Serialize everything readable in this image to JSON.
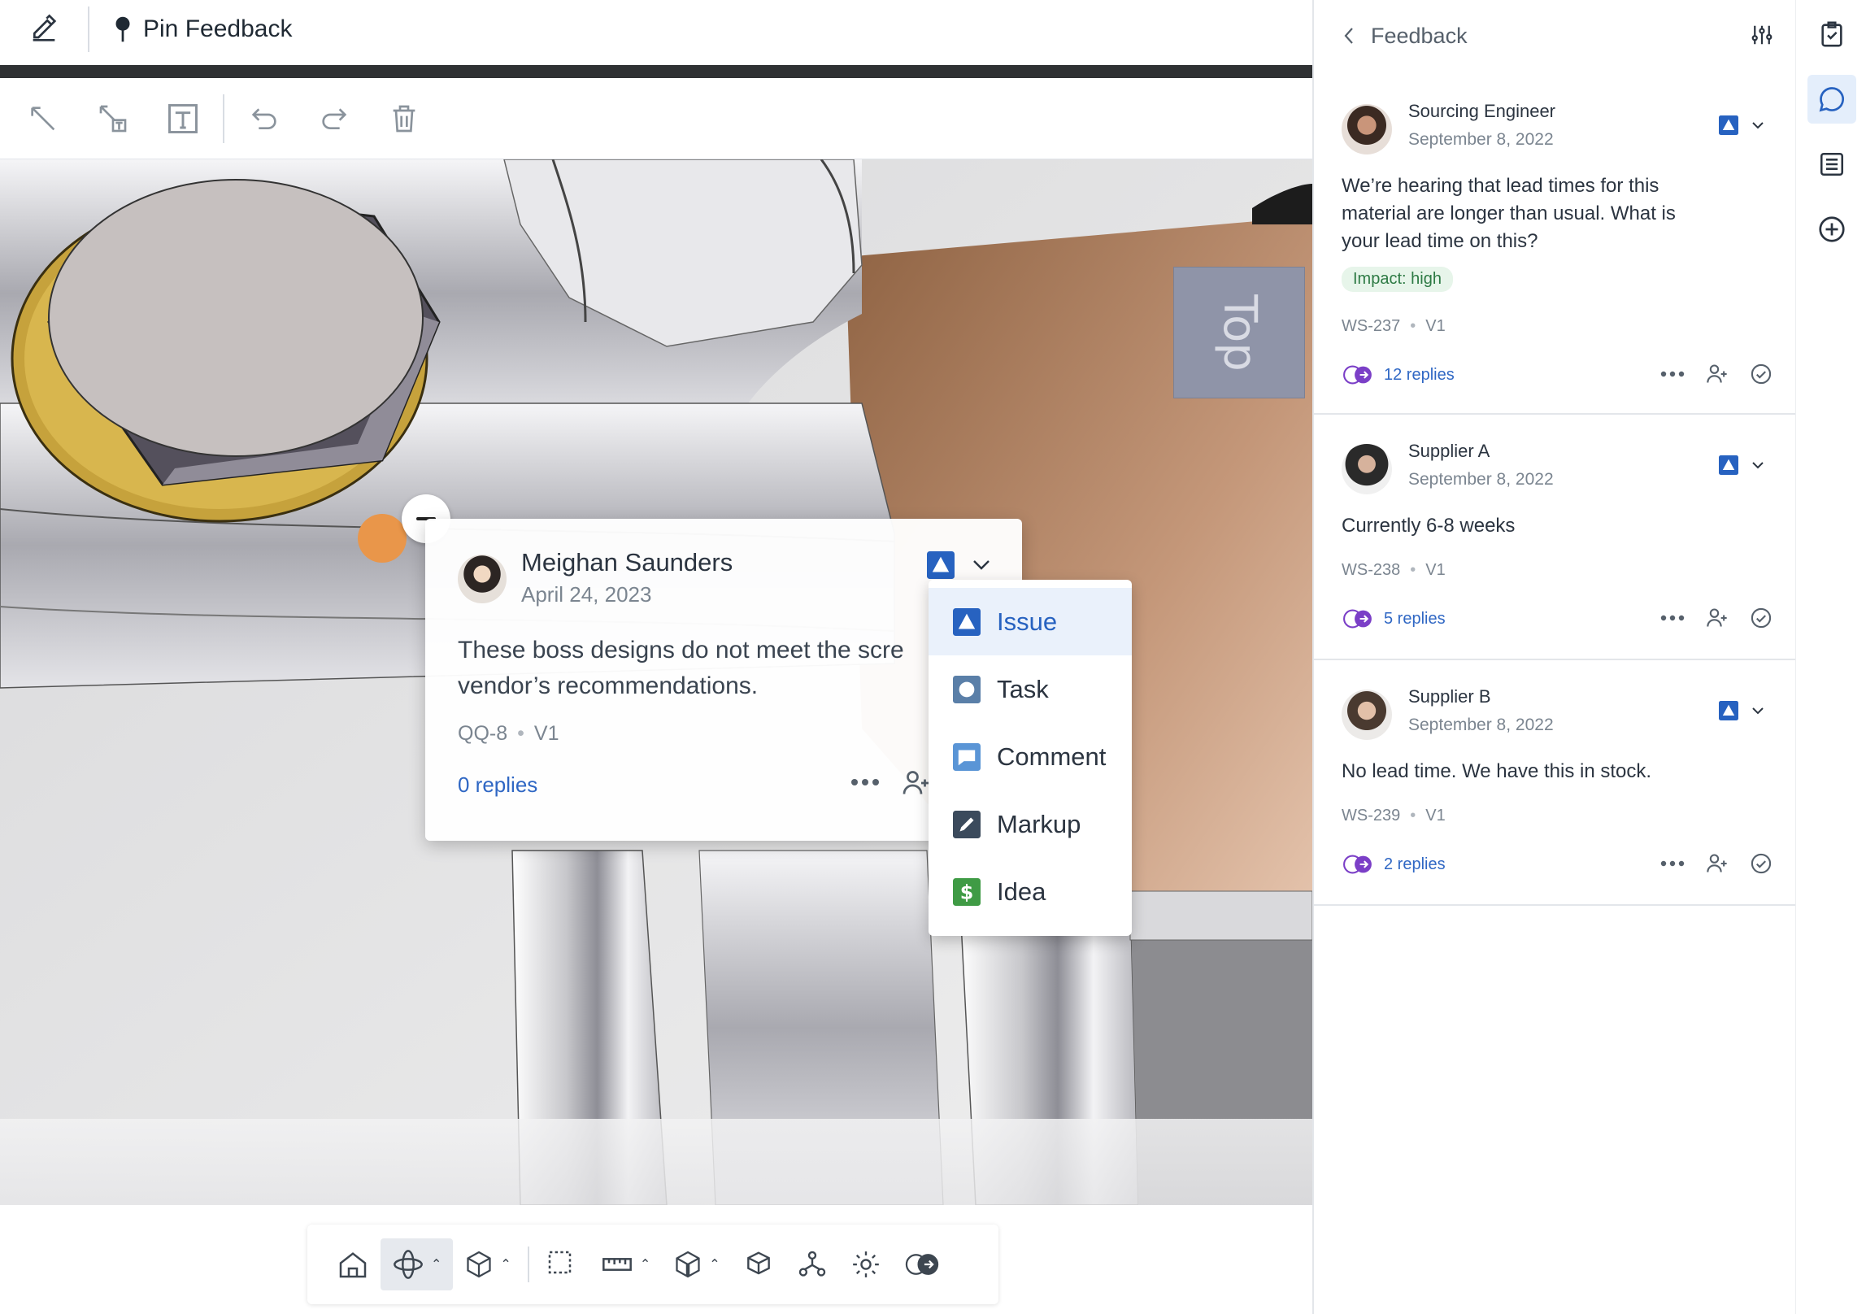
{
  "header": {
    "title": "Pin Feedback"
  },
  "viewcube": {
    "face_label": "Top"
  },
  "popup": {
    "author": "Meighan Saunders",
    "date": "April 24, 2023",
    "body_line1": "These boss designs do not meet the scre",
    "body_line2": "vendor’s recommendations.",
    "id": "QQ-8",
    "version": "V1",
    "replies": "0 replies"
  },
  "type_menu": {
    "items": [
      {
        "label": "Issue",
        "color": "#2762c0",
        "icon": "issue-triangle-icon"
      },
      {
        "label": "Task",
        "color": "#5a7fa8",
        "icon": "task-circle-icon"
      },
      {
        "label": "Comment",
        "color": "#5a95d6",
        "icon": "comment-bubble-icon"
      },
      {
        "label": "Markup",
        "color": "#3b4a5c",
        "icon": "markup-pencil-icon"
      },
      {
        "label": "Idea",
        "color": "#3f9b45",
        "icon": "idea-dollar-icon"
      }
    ],
    "selected": "Issue"
  },
  "panel": {
    "back_label": "Feedback",
    "cards": [
      {
        "author": "Sourcing Engineer",
        "date": "September 8, 2022",
        "text": "We’re hearing that lead times for this material are longer than usual. What is your lead time on this?",
        "tag": "Impact: high",
        "id": "WS-237",
        "version": "V1",
        "replies": "12 replies"
      },
      {
        "author": "Supplier A",
        "date": "September 8, 2022",
        "text": "Currently 6-8 weeks",
        "id": "WS-238",
        "version": "V1",
        "replies": "5 replies"
      },
      {
        "author": "Supplier B",
        "date": "September 8, 2022",
        "text": "No lead time. We have this in stock.",
        "id": "WS-239",
        "version": "V1",
        "replies": "2 replies"
      }
    ]
  },
  "colors": {
    "accent": "#2762c0",
    "pin": "#e9964a",
    "link": "#2f67c4",
    "tag_bg": "#e7f5ea",
    "tag_text": "#2d7a44"
  }
}
